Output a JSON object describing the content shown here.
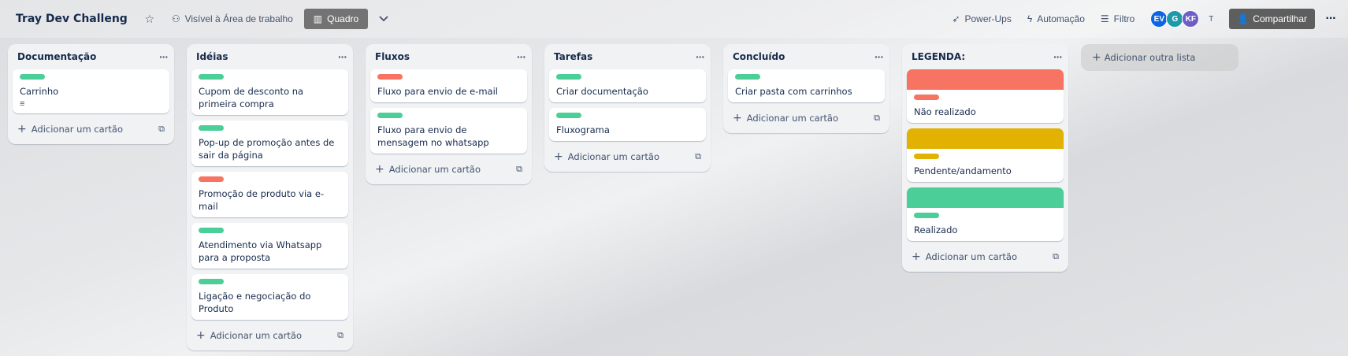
{
  "header": {
    "board_title": "Tray Dev Challeng",
    "visibility": "Visível à Área de trabalho",
    "view": "Quadro",
    "powerups": "Power-Ups",
    "automation": "Automação",
    "filter": "Filtro",
    "avatars": [
      {
        "initials": "EV",
        "color": "#0c66e4"
      },
      {
        "initials": "G",
        "color": "#1d9aaa"
      },
      {
        "initials": "KF",
        "color": "#6e5dc6"
      },
      {
        "initials": "T",
        "color": "transparent"
      }
    ],
    "share": "Compartilhar"
  },
  "colors": {
    "green": "#4bce97",
    "red": "#f87462",
    "yellow": "#e2b203"
  },
  "lists": [
    {
      "title": "Documentação",
      "cards": [
        {
          "text": "Carrinho",
          "label": "green",
          "desc": true
        }
      ],
      "add": "Adicionar um cartão"
    },
    {
      "title": "Idéias",
      "cards": [
        {
          "text": "Cupom de desconto na primeira compra",
          "label": "green"
        },
        {
          "text": "Pop-up de promoção antes de sair da página",
          "label": "green"
        },
        {
          "text": "Promoção de produto via e-mail",
          "label": "red"
        },
        {
          "text": "Atendimento via Whatsapp para a proposta",
          "label": "green"
        },
        {
          "text": "Ligação e negociação do Produto",
          "label": "green"
        }
      ],
      "add": "Adicionar um cartão"
    },
    {
      "title": "Fluxos",
      "cards": [
        {
          "text": "Fluxo para envio de e-mail",
          "label": "red"
        },
        {
          "text": "Fluxo para envio de mensagem no whatsapp",
          "label": "green"
        }
      ],
      "add": "Adicionar um cartão"
    },
    {
      "title": "Tarefas",
      "cards": [
        {
          "text": "Criar documentação",
          "label": "green"
        },
        {
          "text": "Fluxograma",
          "label": "green"
        }
      ],
      "add": "Adicionar um cartão"
    },
    {
      "title": "Concluído",
      "cards": [
        {
          "text": "Criar pasta com carrinhos",
          "label": "green"
        }
      ],
      "add": "Adicionar um cartão"
    },
    {
      "title": "LEGENDA:",
      "cards": [
        {
          "text": "Não realizado",
          "label": "red",
          "cover": "red"
        },
        {
          "text": "Pendente/andamento",
          "label": "yellow",
          "cover": "yellow"
        },
        {
          "text": "Realizado",
          "label": "green",
          "cover": "green"
        }
      ],
      "add": "Adicionar um cartão"
    }
  ],
  "add_list": "Adicionar outra lista"
}
